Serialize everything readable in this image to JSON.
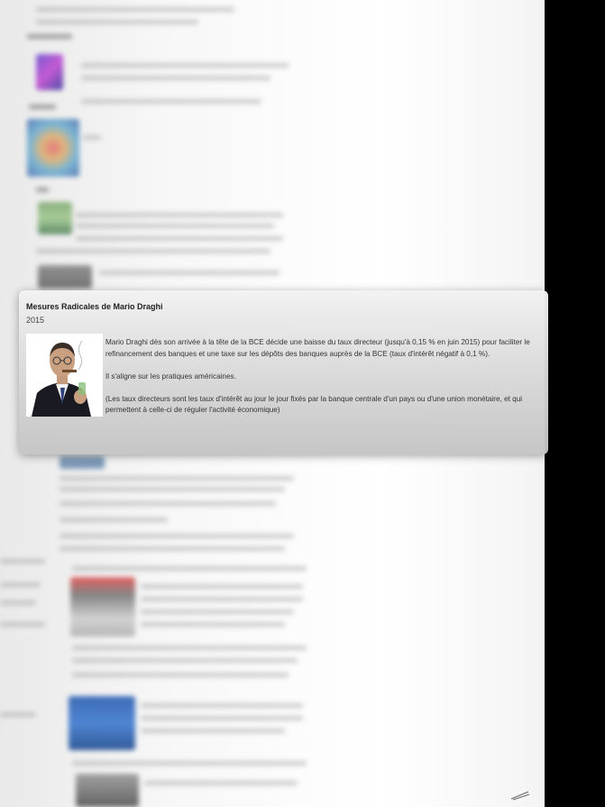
{
  "popup": {
    "title": "Mesures Radicales de Mario Draghi",
    "year": "2015",
    "paragraphs": [
      "Mario Draghi dès son arrivée à la tête de la BCE décide une baisse du taux directeur (jusqu'à 0,15 % en juin 2015) pour faciliter le refinancement des banques et une taxe sur les dépôts des banques auprès de la BCE (taux d'intérêt négatif à 0,1 %).",
      "Il s'aligne sur les pratiques américaines.",
      "(Les taux directeurs sont les taux d'intérêt au jour le jour fixés par la banque centrale d'un pays ou d'une union monétaire, et qui permettent à celle-ci de réguler l'activité économique)"
    ],
    "image": "mario-draghi-portrait"
  },
  "colors": {
    "background": "#000000",
    "page": "#f7f7f7",
    "popup_top": "#f2f2f2",
    "popup_bottom": "#c4c4c4",
    "text": "#333333"
  }
}
